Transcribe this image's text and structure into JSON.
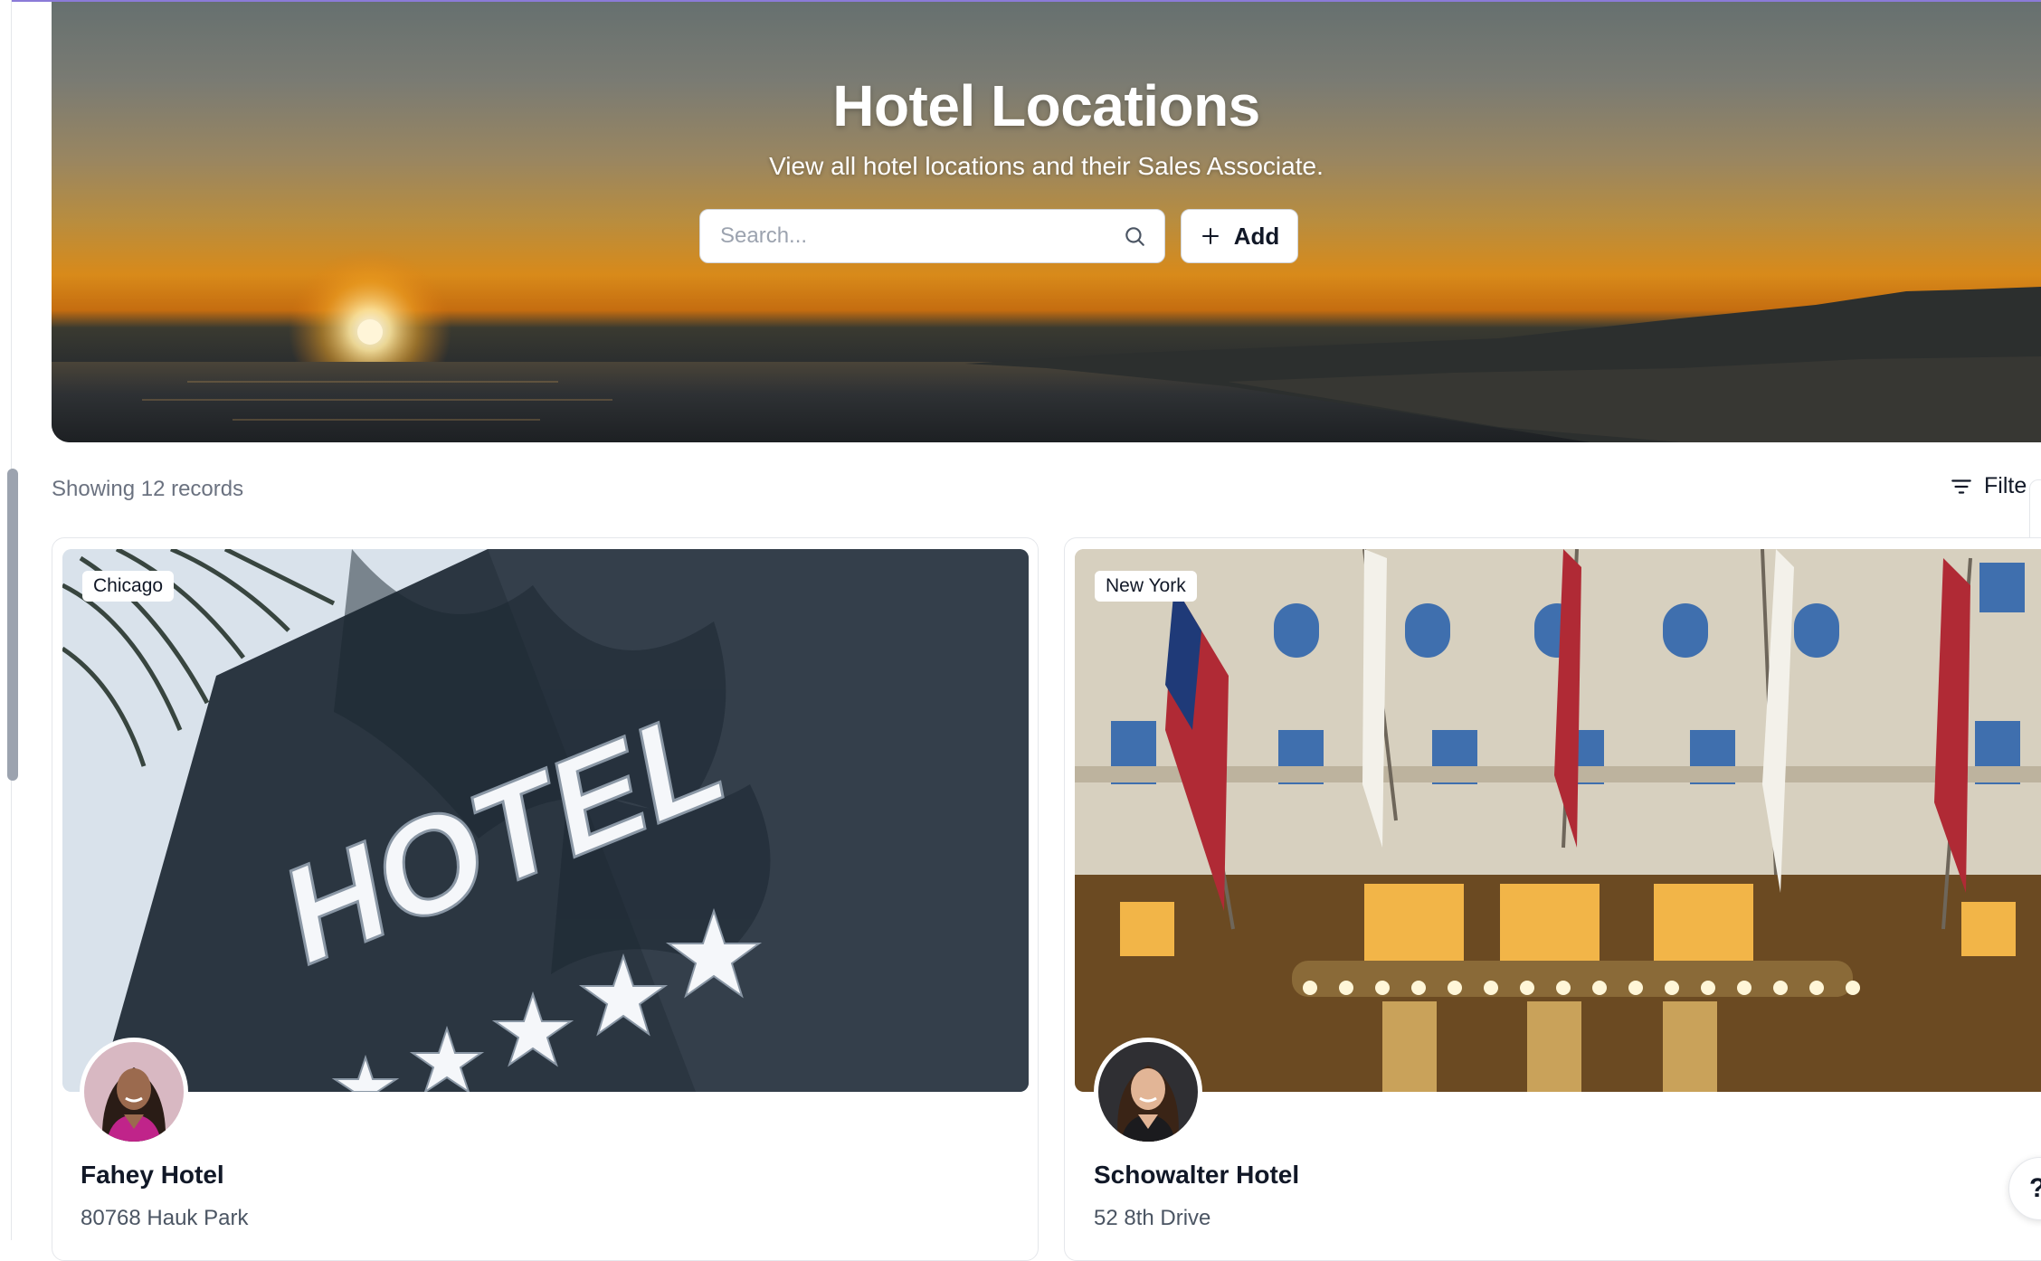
{
  "hero": {
    "title": "Hotel Locations",
    "subtitle": "View all hotel locations and their Sales Associate.",
    "search_placeholder": "Search...",
    "add_label": "Add"
  },
  "toolbar": {
    "records_text": "Showing 12 records",
    "filter_label": "Filte"
  },
  "cards": [
    {
      "city": "Chicago",
      "name": "Fahey Hotel",
      "address": "80768 Hauk Park"
    },
    {
      "city": "New York",
      "name": "Schowalter Hotel",
      "address": "52 8th Drive"
    }
  ],
  "help_label": "?",
  "colors": {
    "accent_line": "#8b7bd8",
    "text": "#111827",
    "muted": "#6b7280"
  },
  "icons": [
    "search-icon",
    "plus-icon",
    "filter-icon",
    "help-icon"
  ]
}
